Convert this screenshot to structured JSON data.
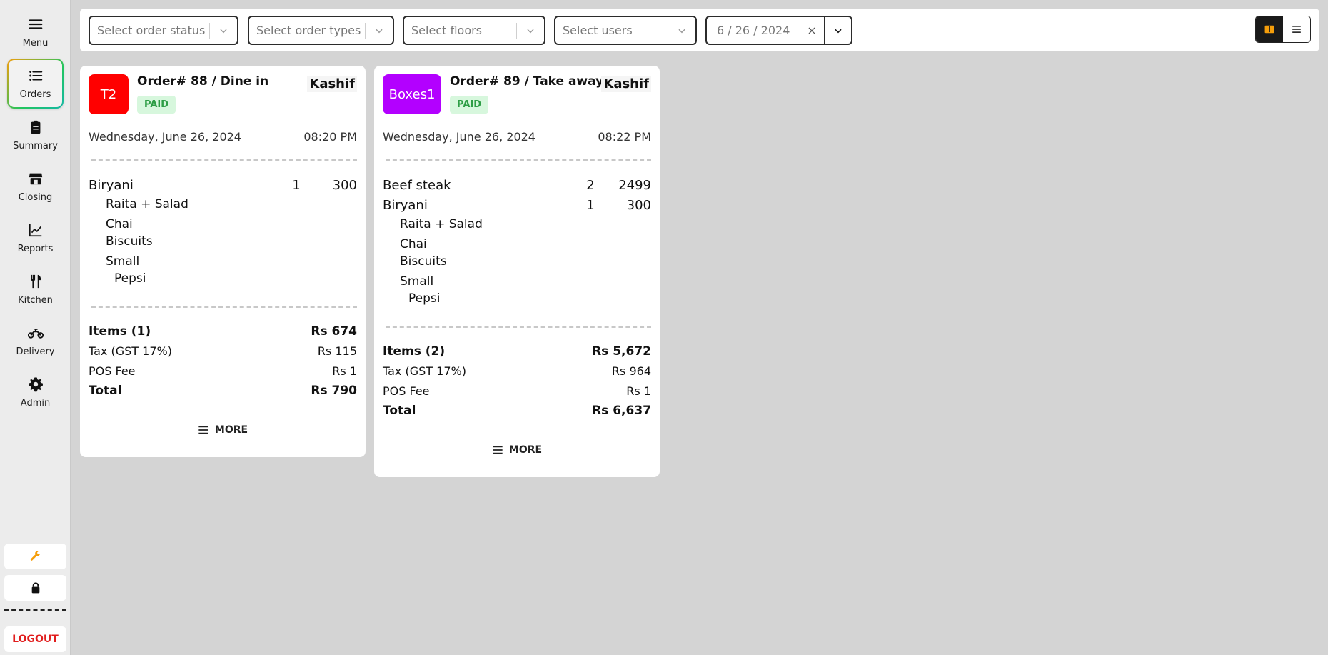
{
  "sidebar": {
    "items": [
      {
        "label": "Menu",
        "icon": "menu-icon"
      },
      {
        "label": "Orders",
        "icon": "list-icon",
        "active": true
      },
      {
        "label": "Summary",
        "icon": "clipboard-icon"
      },
      {
        "label": "Closing",
        "icon": "store-icon"
      },
      {
        "label": "Reports",
        "icon": "chart-icon"
      },
      {
        "label": "Kitchen",
        "icon": "utensils-icon"
      },
      {
        "label": "Delivery",
        "icon": "motorcycle-icon"
      },
      {
        "label": "Admin",
        "icon": "gear-icon"
      }
    ],
    "tools": [
      "wrench-icon",
      "lock-icon"
    ],
    "logout_label": "LOGOUT"
  },
  "filters": {
    "order_status_placeholder": "Select order status",
    "order_types_placeholder": "Select order types",
    "floors_placeholder": "Select floors",
    "users_placeholder": "Select users",
    "date_value": "6 / 26 / 2024"
  },
  "colors": {
    "accent": "#f59e0b",
    "paid_bg": "#d7f7dd",
    "paid_text": "#2e9e46",
    "badge_t2": "#ff0000",
    "badge_boxes1": "#b300ff"
  },
  "orders": [
    {
      "badge": "T2",
      "title": "Order# 88 / Dine in",
      "status": "PAID",
      "server": "Kashif",
      "date": "Wednesday, June 26, 2024",
      "time": "08:20 PM",
      "items": [
        {
          "name": "Biryani",
          "qty": "1",
          "price": "300"
        }
      ],
      "subitems": [
        "Raita + Salad",
        "Chai",
        "Biscuits",
        "Small",
        "Pepsi"
      ],
      "summary": {
        "items_label": "Items (1)",
        "items_value": "Rs 674",
        "tax_label": "Tax (GST 17%)",
        "tax_value": "Rs 115",
        "fee_label": "POS Fee",
        "fee_value": "Rs 1",
        "total_label": "Total",
        "total_value": "Rs 790"
      },
      "more_label": "MORE"
    },
    {
      "badge": "Boxes1",
      "title": "Order# 89 / Take away",
      "status": "PAID",
      "server": "Kashif",
      "date": "Wednesday, June 26, 2024",
      "time": "08:22 PM",
      "items": [
        {
          "name": "Beef steak",
          "qty": "2",
          "price": "2499"
        },
        {
          "name": "Biryani",
          "qty": "1",
          "price": "300"
        }
      ],
      "subitems": [
        "Raita + Salad",
        "Chai",
        "Biscuits",
        "Small",
        "Pepsi"
      ],
      "summary": {
        "items_label": "Items (2)",
        "items_value": "Rs 5,672",
        "tax_label": "Tax (GST 17%)",
        "tax_value": "Rs 964",
        "fee_label": "POS Fee",
        "fee_value": "Rs 1",
        "total_label": "Total",
        "total_value": "Rs 6,637"
      },
      "more_label": "MORE"
    }
  ]
}
